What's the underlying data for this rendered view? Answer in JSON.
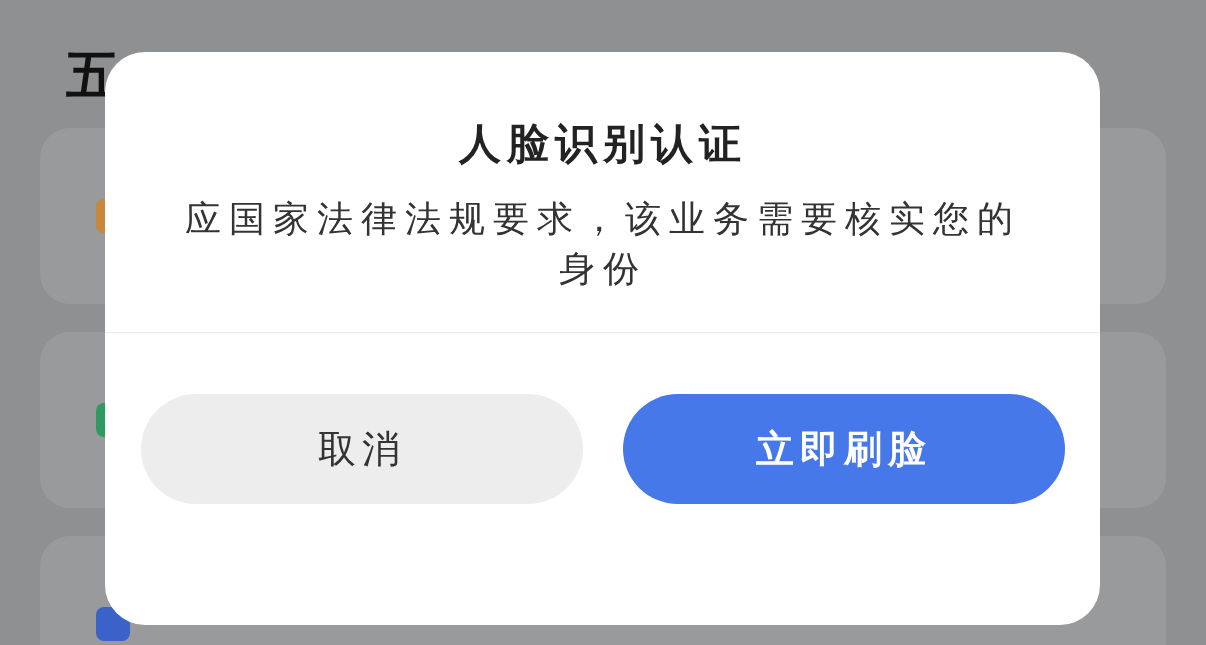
{
  "page": {
    "title": "五"
  },
  "cards": [
    {
      "color": "#c8873a"
    },
    {
      "color": "#2e9a62"
    },
    {
      "color": "#3a62c8"
    }
  ],
  "dialog": {
    "title": "人脸识别认证",
    "message": "应国家法律法规要求，该业务需要核实您的身份",
    "buttons": [
      {
        "kind": "secondary",
        "label": "取消"
      },
      {
        "kind": "primary",
        "label": "立即刷脸"
      }
    ]
  }
}
